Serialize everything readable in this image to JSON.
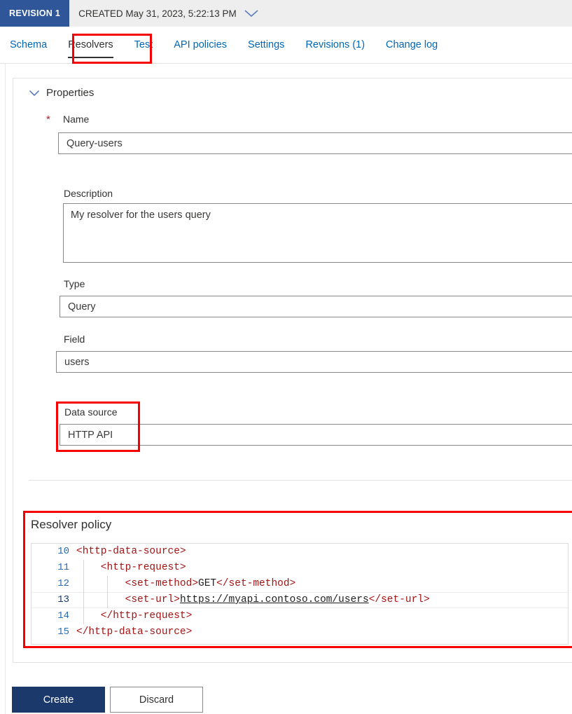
{
  "revision_bar": {
    "badge": "REVISION 1",
    "created_text": "CREATED May 31, 2023, 5:22:13 PM",
    "chevron_icon": "chevron-down-icon"
  },
  "tabs": [
    {
      "label": "Schema",
      "active": false
    },
    {
      "label": "Resolvers",
      "active": true
    },
    {
      "label": "Test",
      "active": false
    },
    {
      "label": "API policies",
      "active": false
    },
    {
      "label": "Settings",
      "active": false
    },
    {
      "label": "Revisions (1)",
      "active": false
    },
    {
      "label": "Change log",
      "active": false
    }
  ],
  "properties": {
    "section_title": "Properties",
    "collapse_icon": "chevron-down-icon",
    "required_marker": "*",
    "name": {
      "label": "Name",
      "value": "Query-users"
    },
    "description": {
      "label": "Description",
      "value": "My resolver for the users query"
    },
    "type": {
      "label": "Type",
      "value": "Query"
    },
    "field": {
      "label": "Field",
      "value": "users"
    },
    "data_source": {
      "label": "Data source",
      "value": "HTTP API"
    }
  },
  "resolver_policy": {
    "title": "Resolver policy",
    "lines": [
      {
        "number": "10",
        "indent": 0,
        "current": false,
        "tokens": [
          {
            "t": "tag",
            "s": "<http-data-source>"
          }
        ]
      },
      {
        "number": "11",
        "indent": 1,
        "current": false,
        "tokens": [
          {
            "t": "tag",
            "s": "    <http-request>"
          }
        ]
      },
      {
        "number": "12",
        "indent": 2,
        "current": false,
        "tokens": [
          {
            "t": "tag",
            "s": "        <set-method>"
          },
          {
            "t": "plain",
            "s": "GET"
          },
          {
            "t": "tag",
            "s": "</set-method>"
          }
        ]
      },
      {
        "number": "13",
        "indent": 2,
        "current": true,
        "tokens": [
          {
            "t": "tag",
            "s": "        <set-url>"
          },
          {
            "t": "link",
            "s": "https://myapi.contoso.com/users"
          },
          {
            "t": "tag",
            "s": "</set-url>"
          }
        ]
      },
      {
        "number": "14",
        "indent": 1,
        "current": false,
        "tokens": [
          {
            "t": "tag",
            "s": "    </http-request>"
          }
        ]
      },
      {
        "number": "15",
        "indent": 0,
        "current": false,
        "tokens": [
          {
            "t": "tag",
            "s": "</http-data-source>"
          }
        ]
      }
    ]
  },
  "footer": {
    "create_label": "Create",
    "discard_label": "Discard"
  },
  "annotations": {
    "highlight_color": "#f50000",
    "boxes": [
      {
        "name": "resolvers-tab-highlight"
      },
      {
        "name": "data-source-highlight"
      },
      {
        "name": "resolver-policy-highlight"
      }
    ]
  },
  "colors": {
    "revision_badge": "#2f5699",
    "link_blue": "#0067b8",
    "primary_button": "#1b3a6b",
    "required_star": "#a4262c",
    "code_tag": "#a31515",
    "gutter_number": "#2b6cb0"
  }
}
